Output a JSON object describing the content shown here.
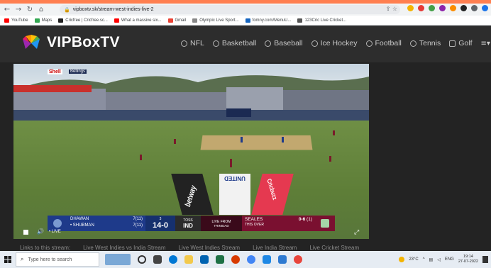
{
  "browser": {
    "url": "vipboxtv.sk/stream-west-indies-live-2",
    "bookmarks": [
      {
        "label": "YouTube",
        "color": "#ff0000"
      },
      {
        "label": "Maps",
        "color": "#34a853"
      },
      {
        "label": "Cricfree | Cricfree.sc...",
        "color": "#222222"
      },
      {
        "label": "What a massive six...",
        "color": "#ff0000"
      },
      {
        "label": "Gmail",
        "color": "#ea4335"
      },
      {
        "label": "Olympic Live Sport...",
        "color": "#888888"
      },
      {
        "label": "fomny.com/MenuU...",
        "color": "#1565c0"
      },
      {
        "label": "123Cric Live Cricket...",
        "color": "#555555"
      }
    ]
  },
  "site": {
    "logo_text": "VIPBoxTV",
    "nav": [
      {
        "label": "NFL",
        "icon": "football-icon"
      },
      {
        "label": "Basketball",
        "icon": "basketball-icon"
      },
      {
        "label": "Baseball",
        "icon": "baseball-icon"
      },
      {
        "label": "Ice Hockey",
        "icon": "hockey-icon"
      },
      {
        "label": "Football",
        "icon": "soccer-icon"
      },
      {
        "label": "Tennis",
        "icon": "tennis-icon"
      },
      {
        "label": "Golf",
        "icon": "golf-icon"
      }
    ],
    "menu_glyph": "≡▾"
  },
  "stadium": {
    "stand_sign": "Shell",
    "stand_sign_2": "Bellings"
  },
  "scorebug": {
    "batter1": "DHAWAN",
    "batter1_runs": "7",
    "batter1_balls": "(11)",
    "batter2": "• SHUBMAN",
    "batter2_runs": "7",
    "batter2_balls": "(11)",
    "over_label": "3",
    "score": "14-0",
    "toss_label": "TOSS",
    "toss_team": "IND",
    "live_from": "LIVE FROM",
    "venue": "TRINIDAD",
    "bowler": "SEALES",
    "bowler_fig": "0-6",
    "bowler_overs": "(1)",
    "this_over": "THIS OVER"
  },
  "player": {
    "live_label": "• LIVE",
    "adboards": [
      "betway",
      "UNITED",
      "Cricbuzz"
    ]
  },
  "links_row": [
    "Links to this stream:",
    "Live West Indies vs India Stream",
    "Live West Indies Stream",
    "Live India Stream",
    "Live Cricket Stream"
  ],
  "taskbar": {
    "search_placeholder": "Type here to search",
    "temp": "23°C",
    "lang": "ENG",
    "time": "19:14",
    "date": "27-07-2022"
  },
  "colors": {
    "accent_orange": "#ff7f50",
    "header_bg": "#2d2d2d",
    "page_bg": "#232323",
    "scorebug_blue": "#1e3a8a",
    "scorebug_maroon": "#7a1030"
  }
}
